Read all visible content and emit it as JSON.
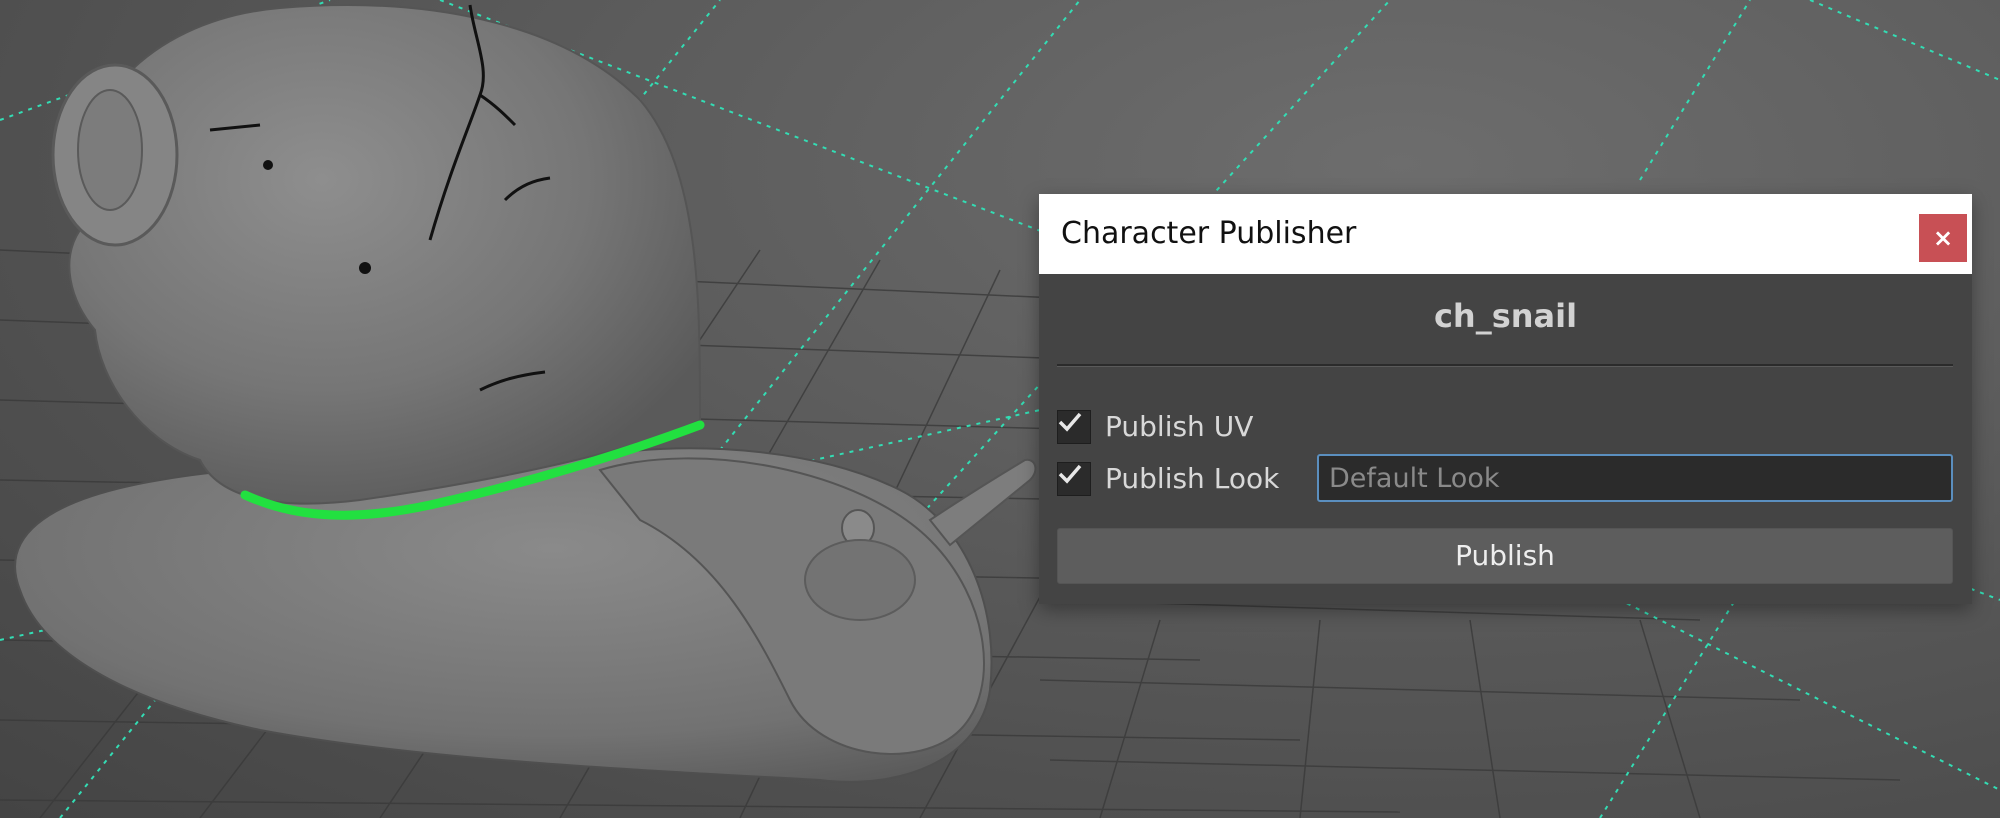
{
  "viewport": {
    "background_color": "#5a5a5a",
    "grid_color": "#3a3a3a",
    "guide_color": "#33ddb4",
    "selection_color": "#22e040",
    "mesh_color": "#7c7c7c"
  },
  "dialog": {
    "title": "Character Publisher",
    "close_icon": "close-icon",
    "close_label": "×",
    "close_color": "#c85055",
    "asset_name": "ch_snail",
    "options": {
      "publish_uv": {
        "label": "Publish UV",
        "checked": true
      },
      "publish_look": {
        "label": "Publish Look",
        "checked": true
      }
    },
    "look_input": {
      "value": "",
      "placeholder": "Default Look"
    },
    "publish_label": "Publish",
    "focus_color": "#5b8fbf"
  }
}
